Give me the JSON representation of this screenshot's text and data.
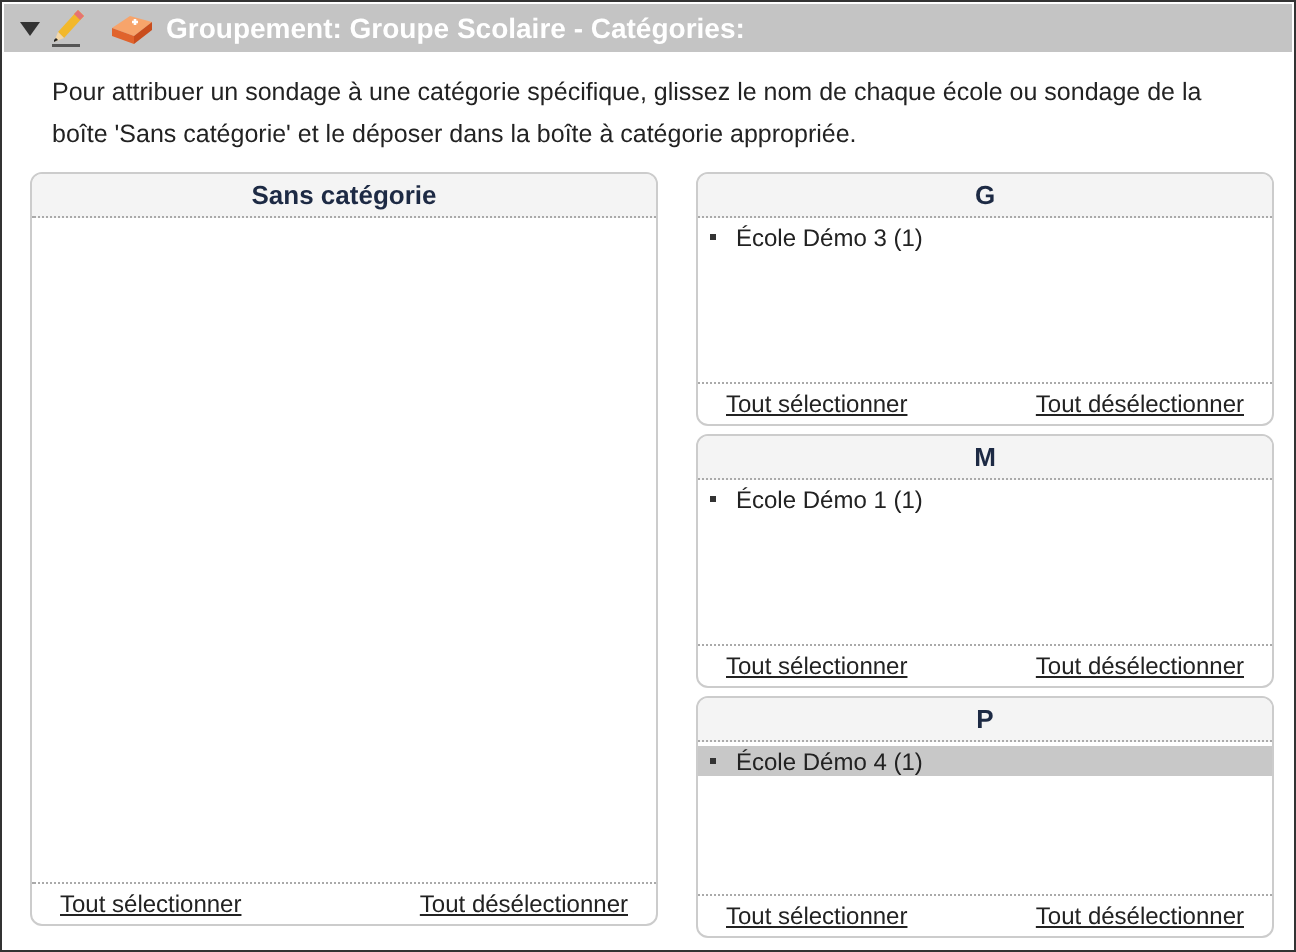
{
  "panel": {
    "title": "Groupement: Groupe Scolaire - Catégories:",
    "expanded": true
  },
  "instructions": "Pour attribuer un sondage à une catégorie spécifique, glissez le nom de chaque école ou sondage de la boîte 'Sans catégorie' et le déposer  dans la boîte à catégorie appropriée.",
  "uncategorized": {
    "title": "Sans catégorie",
    "select_all": "Tout sélectionner",
    "deselect_all": "Tout désélectionner"
  },
  "categories": [
    {
      "title": "G",
      "items": [
        {
          "label": "École Démo 3 (1)",
          "selected": false
        }
      ],
      "select_all": "Tout sélectionner",
      "deselect_all": "Tout désélectionner"
    },
    {
      "title": "M",
      "items": [
        {
          "label": "École Démo 1 (1)",
          "selected": false
        }
      ],
      "select_all": "Tout sélectionner",
      "deselect_all": "Tout désélectionner"
    },
    {
      "title": "P",
      "items": [
        {
          "label": "École Démo 4 (1)",
          "selected": true
        }
      ],
      "select_all": "Tout sélectionner",
      "deselect_all": "Tout désélectionner"
    }
  ]
}
